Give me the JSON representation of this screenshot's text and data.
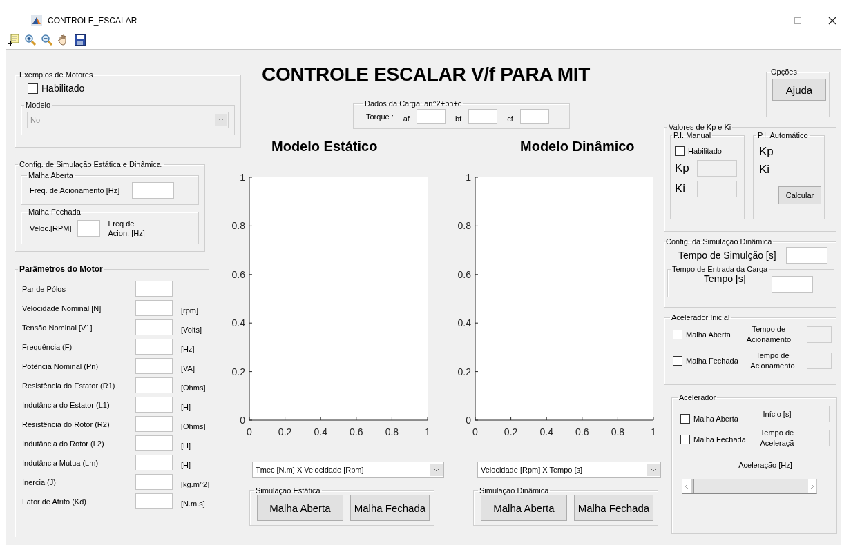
{
  "window": {
    "title": "CONTROLE_ESCALAR"
  },
  "heading": "CONTROLE ESCALAR V/f PARA MIT",
  "motor_examples": {
    "title": "Exemplos de Motores",
    "enable": {
      "label": "Habilitado",
      "checked": false
    },
    "model": {
      "title": "Modelo",
      "value": "No",
      "disabled": true
    }
  },
  "sim_config": {
    "title": "Config. de Simulação Estática e Dinâmica.",
    "open_loop": {
      "title": "Malha Aberta",
      "label": "Freq. de Acionamento [Hz]"
    },
    "closed_loop": {
      "title": "Malha Fechada",
      "speed_label": "Veloc.[RPM]",
      "freq_label": "Freq de Acion. [Hz]"
    }
  },
  "motor_params": {
    "title": "Parâmetros do Motor",
    "rows": [
      {
        "label": "Par de Pólos"
      },
      {
        "label": "Velocidade Nominal [N]",
        "unit": "[rpm]"
      },
      {
        "label": "Tensão Nominal [V1]",
        "unit": "[Volts]"
      },
      {
        "label": "Frequência (F)",
        "unit": "[Hz]"
      },
      {
        "label": "Potência Nominal (Pn)",
        "unit": "[VA]"
      },
      {
        "label": "Resistência do Estator (R1)",
        "unit": "[Ohms]"
      },
      {
        "label": "Indutância do Estator (L1)",
        "unit": "[H]"
      },
      {
        "label": "Resistência do Rotor (R2)",
        "unit": "[Ohms]"
      },
      {
        "label": "Indutância do Rotor (L2)",
        "unit": "[H]"
      },
      {
        "label": "Indutância Mutua (Lm)",
        "unit": "[H]"
      },
      {
        "label": "Inercia (J)",
        "unit": "[kg.m^2]"
      },
      {
        "label": "Fator de Atrito (Kd)",
        "unit": "[N.m.s]"
      }
    ]
  },
  "load": {
    "title": "Dados da Carga: an^2+bn+c",
    "label": "Torque :",
    "fields": [
      "af",
      "bf",
      "cf"
    ]
  },
  "plots": [
    {
      "title": "Modelo Estático",
      "chart_data": {
        "type": "line",
        "xlim": [
          0,
          1
        ],
        "ylim": [
          0,
          1
        ],
        "xticks": [
          0,
          0.2,
          0.4,
          0.6,
          0.8,
          1
        ],
        "yticks": [
          0,
          0.2,
          0.4,
          0.6,
          0.8,
          1
        ]
      },
      "selector": "Tmec [N.m] X Velocidade [Rpm]",
      "group": {
        "title": "Simulação Estática",
        "buttons": [
          "Malha Aberta",
          "Malha Fechada"
        ]
      }
    },
    {
      "title": "Modelo Dinâmico",
      "chart_data": {
        "type": "line",
        "xlim": [
          0,
          1
        ],
        "ylim": [
          0,
          1
        ],
        "xticks": [
          0,
          0.2,
          0.4,
          0.6,
          0.8,
          1
        ],
        "yticks": [
          0,
          0.2,
          0.4,
          0.6,
          0.8,
          1
        ]
      },
      "selector": "Velocidade [Rpm] X Tempo [s]",
      "group": {
        "title": "Simulação Dinâmica",
        "buttons": [
          "Malha Aberta",
          "Malha Fechada"
        ]
      }
    }
  ],
  "options": {
    "title": "Opções",
    "button": "Ajuda"
  },
  "gains": {
    "title": "Valores de Kp e Ki",
    "manual": {
      "title": "P.I. Manual",
      "enable": {
        "label": "Habilitado",
        "checked": false
      },
      "fields": [
        {
          "label": "Kp",
          "disabled": true
        },
        {
          "label": "Ki",
          "disabled": true
        }
      ]
    },
    "auto": {
      "title": "P.I. Automático",
      "labels": [
        "Kp",
        "Ki"
      ],
      "button": "Calcular"
    }
  },
  "dynamic_config": {
    "title": "Config. da Simulação Dinâmica",
    "sim_time_label": "Tempo de Simulção [s]",
    "load_entry": {
      "title": "Tempo de Entrada da Carga",
      "label": "Tempo [s]"
    }
  },
  "initial_accel": {
    "title": "Acelerador Inicial",
    "rows": [
      {
        "label": "Malha Aberta",
        "checked": false,
        "time_label": "Tempo de Acionamento",
        "disabled": true
      },
      {
        "label": "Malha Fechada",
        "checked": false,
        "time_label": "Tempo de Acionamento",
        "disabled": true
      }
    ]
  },
  "accelerator": {
    "title": "Acelerador",
    "checks": [
      {
        "label": "Malha Aberta",
        "checked": false
      },
      {
        "label": "Malha Fechada",
        "checked": false
      }
    ],
    "fields": [
      {
        "label": "Início [s]",
        "disabled": true
      },
      {
        "label": "Tempo de Aceleraçã",
        "disabled": true
      }
    ],
    "slider_label": "Aceleração [Hz]",
    "slider": {
      "level": 0
    }
  }
}
